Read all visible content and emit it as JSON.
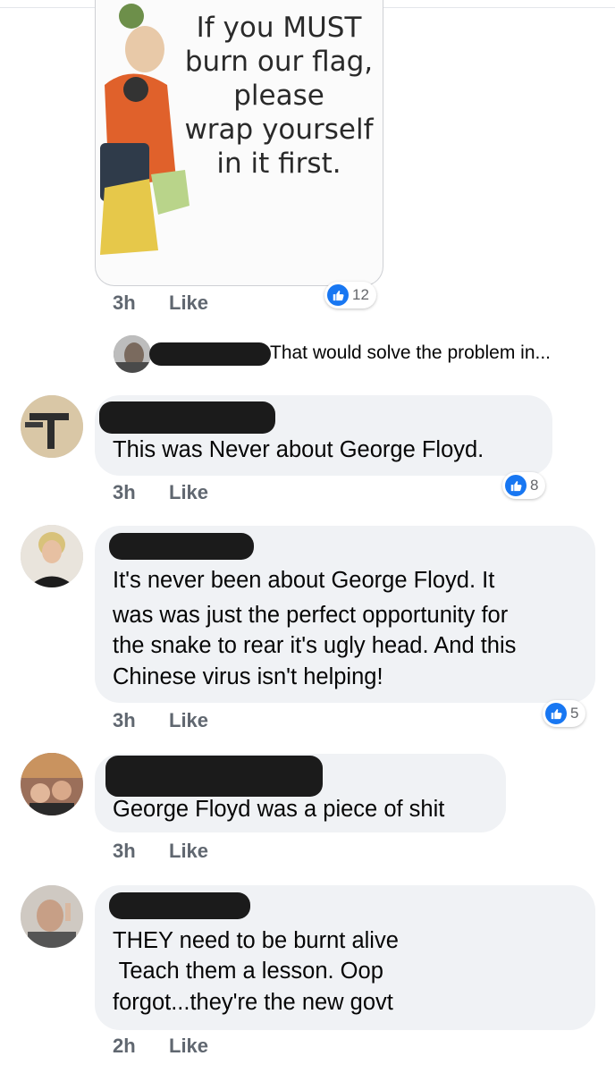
{
  "meme": {
    "lines": [
      "If you MUST",
      "burn our flag,",
      "please",
      "wrap yourself",
      "in it first."
    ]
  },
  "comments": [
    {
      "time": "3h",
      "like": "Like",
      "reactions": "12"
    },
    {
      "time": "3h",
      "like": "Like",
      "reactions": "8",
      "text": "This was Never about George Floyd."
    },
    {
      "time": "3h",
      "like": "Like",
      "reactions": "5",
      "lines": [
        "It's never been about George Floyd. It",
        "was was just the perfect opportunity for",
        "the snake to rear it's ugly head. And this",
        "Chinese virus isn't helping!"
      ]
    },
    {
      "time": "3h",
      "like": "Like",
      "text": "George Floyd was a piece of shit"
    },
    {
      "time": "2h",
      "like": "Like",
      "lines": [
        "THEY need to be burnt alive",
        " Teach them a lesson. Oop",
        "forgot...they're the new govt"
      ]
    }
  ],
  "reply": {
    "text": "That would solve the problem in..."
  },
  "colors": {
    "like_blue": "#1877f2",
    "bubble_bg": "#f0f2f5"
  }
}
